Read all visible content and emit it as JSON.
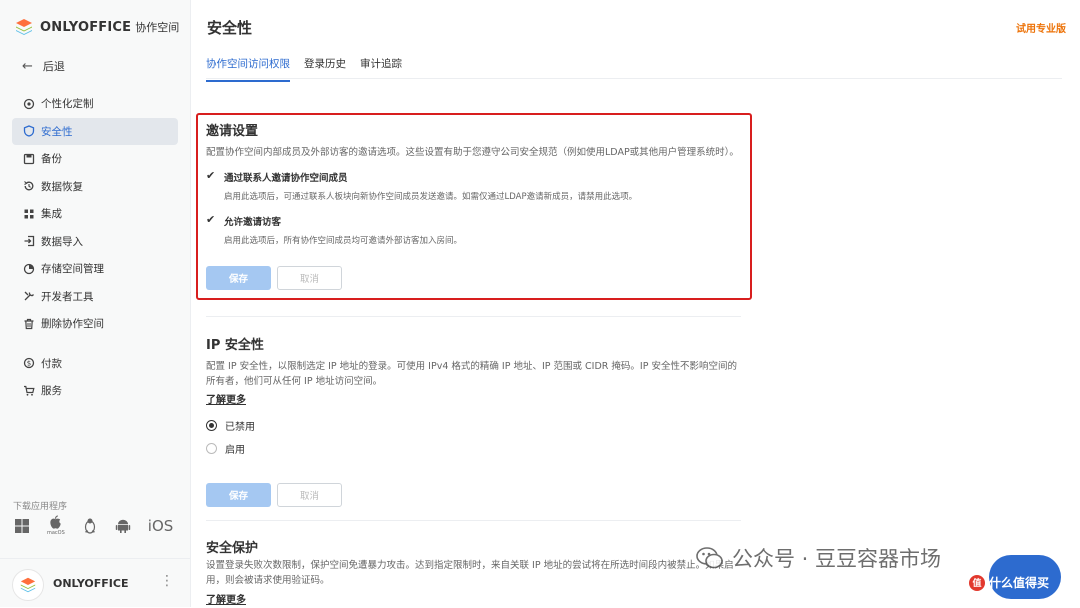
{
  "app": {
    "logo_text": "ONLYOFFICE",
    "logo_sub": "协作空间",
    "back_label": "后退"
  },
  "sidebar": {
    "items": [
      {
        "label": "个性化定制",
        "icon": "customize-icon"
      },
      {
        "label": "安全性",
        "icon": "shield-icon",
        "active": true
      },
      {
        "label": "备份",
        "icon": "save-icon"
      },
      {
        "label": "数据恢复",
        "icon": "restore-icon"
      },
      {
        "label": "集成",
        "icon": "grid-icon"
      },
      {
        "label": "数据导入",
        "icon": "import-icon"
      },
      {
        "label": "存储空间管理",
        "icon": "pie-icon"
      },
      {
        "label": "开发者工具",
        "icon": "tools-icon"
      },
      {
        "label": "删除协作空间",
        "icon": "trash-icon"
      },
      {
        "label": "付款",
        "icon": "payment-icon"
      },
      {
        "label": "服务",
        "icon": "cart-icon"
      }
    ],
    "apps_label": "下载应用程序",
    "apps": [
      {
        "name": "windows-icon"
      },
      {
        "name": "apple-icon",
        "caption": "macOS"
      },
      {
        "name": "linux-icon"
      },
      {
        "name": "android-icon"
      },
      {
        "name": "ios-icon",
        "text": "iOS"
      }
    ],
    "profile_name": "ONLYOFFICE"
  },
  "header": {
    "title": "安全性",
    "trial_link": "试用专业版"
  },
  "tabs": [
    {
      "label": "协作空间访问权限",
      "active": true
    },
    {
      "label": "登录历史"
    },
    {
      "label": "审计追踪"
    }
  ],
  "invite": {
    "title": "邀请设置",
    "description": "配置协作空间内部成员及外部访客的邀请选项。这些设置有助于您遵守公司安全规范（例如使用LDAP或其他用户管理系统时）。",
    "options": [
      {
        "label": "通过联系人邀请协作空间成员",
        "desc": "启用此选项后，可通过联系人板块向新协作空间成员发送邀请。如需仅通过LDAP邀请新成员，请禁用此选项。",
        "checked": true
      },
      {
        "label": "允许邀请访客",
        "desc": "启用此选项后，所有协作空间成员均可邀请外部访客加入房间。",
        "checked": true
      }
    ],
    "save": "保存",
    "cancel": "取消"
  },
  "ip": {
    "title": "IP 安全性",
    "description": "配置 IP 安全性，以限制选定 IP 地址的登录。可使用 IPv4 格式的精确 IP 地址、IP 范围或 CIDR 掩码。IP 安全性不影响空间的所有者，他们可从任何 IP 地址访问空间。",
    "learn_more": "了解更多",
    "radios": [
      {
        "label": "已禁用",
        "selected": true
      },
      {
        "label": "启用",
        "selected": false
      }
    ],
    "save": "保存",
    "cancel": "取消"
  },
  "brute": {
    "title": "安全保护",
    "description": "设置登录失败次数限制，保护空间免遭暴力攻击。达到指定限制时，来自关联 IP 地址的尝试将在所选时间段内被禁止。如果启用，则会被请求使用验证码。",
    "learn_more": "了解更多"
  },
  "watermark": {
    "text": "公众号 · 豆豆容器市场",
    "zdm": "什么值得买"
  },
  "colors": {
    "accent": "#2d6bcf",
    "trial": "#ed7309",
    "highlight": "#d81e1e",
    "save_button": "#a5c8f2"
  }
}
